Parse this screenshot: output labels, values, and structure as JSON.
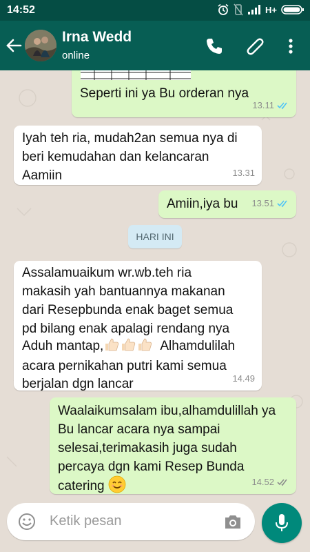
{
  "status_bar": {
    "time": "14:52",
    "network": "H+"
  },
  "header": {
    "contact_name": "Irna Wedd",
    "contact_status": "online"
  },
  "colors": {
    "header": "#075e54",
    "status_bar": "#054d44",
    "outgoing_bubble": "#dcf8c6",
    "incoming_bubble": "#ffffff",
    "read_ticks": "#4fc3f7",
    "mic_button": "#00897b"
  },
  "messages": [
    {
      "direction": "outgoing",
      "text": "Seperti ini ya Bu orderan nya",
      "time": "13.11",
      "ticks": "read"
    },
    {
      "direction": "incoming",
      "lines": [
        "Iyah teh ria, mudah2an semua nya di",
        "beri kemudahan dan kelancaran",
        "Aamiin"
      ],
      "time": "13.31"
    },
    {
      "direction": "outgoing",
      "text": "Amiin,iya bu",
      "time": "13.51",
      "ticks": "read"
    },
    {
      "direction": "incoming",
      "lines": [
        "Assalamuaikum wr.wb.teh ria",
        "makasih yah bantuannya makanan",
        "dari  Resepbunda enak baget semua",
        "pd bilang enak apalagi rendang nya",
        "Aduh mantap,",
        "Alhamdulilah",
        "acara  pernikahan putri kami  semua",
        "berjalan dgn lancar"
      ],
      "time": "14.49",
      "emoji": "thumbs-up x3"
    },
    {
      "direction": "outgoing",
      "lines": [
        "Waalaikumsalam ibu,alhamdulillah ya",
        "Bu lancar acara nya sampai",
        "selesai,terimakasih juga sudah",
        "percaya dgn kami Resep Bunda",
        "catering"
      ],
      "time": "14.52",
      "ticks": "delivered",
      "emoji": "smiling-face"
    }
  ],
  "day_divider": "HARI INI",
  "composer": {
    "placeholder": "Ketik pesan"
  }
}
